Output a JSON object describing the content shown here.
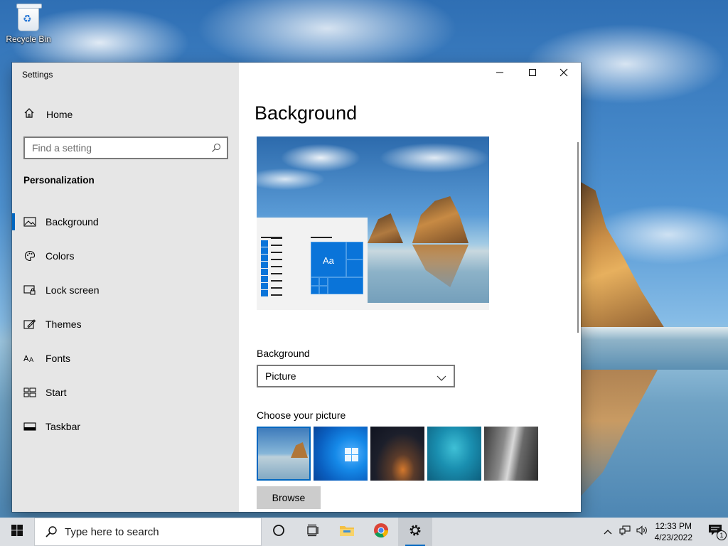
{
  "desktop": {
    "recycle_bin_label": "Recycle Bin"
  },
  "window": {
    "title": "Settings",
    "controls": {
      "minimize_icon": "minimize-icon",
      "maximize_icon": "maximize-icon",
      "close_icon": "close-icon"
    }
  },
  "sidebar": {
    "home_label": "Home",
    "search_placeholder": "Find a setting",
    "section_title": "Personalization",
    "items": [
      {
        "label": "Background",
        "icon": "picture-icon",
        "active": true
      },
      {
        "label": "Colors",
        "icon": "palette-icon",
        "active": false
      },
      {
        "label": "Lock screen",
        "icon": "lock-screen-icon",
        "active": false
      },
      {
        "label": "Themes",
        "icon": "themes-icon",
        "active": false
      },
      {
        "label": "Fonts",
        "icon": "fonts-icon",
        "active": false
      },
      {
        "label": "Start",
        "icon": "start-icon",
        "active": false
      },
      {
        "label": "Taskbar",
        "icon": "taskbar-icon",
        "active": false
      }
    ]
  },
  "main": {
    "page_title": "Background",
    "preview": {
      "tile_text": "Aa"
    },
    "background_label": "Background",
    "background_select_value": "Picture",
    "choose_picture_label": "Choose your picture",
    "pictures": [
      {
        "name": "beach-rocks",
        "selected": true
      },
      {
        "name": "windows-blue",
        "selected": false
      },
      {
        "name": "night-sky",
        "selected": false
      },
      {
        "name": "underwater-swimmer",
        "selected": false
      },
      {
        "name": "rock-waterfall",
        "selected": false
      }
    ],
    "browse_label": "Browse"
  },
  "taskbar": {
    "search_placeholder": "Type here to search",
    "apps": [
      "cortana-icon",
      "task-view-icon",
      "file-explorer-icon",
      "chrome-icon",
      "settings-gear-icon"
    ],
    "time": "12:33 PM",
    "date": "4/23/2022",
    "notification_count": "1"
  },
  "colors": {
    "accent": "#0067c0",
    "sidebar_bg": "#e6e6e6",
    "taskbar_bg": "#dcdfe3"
  }
}
